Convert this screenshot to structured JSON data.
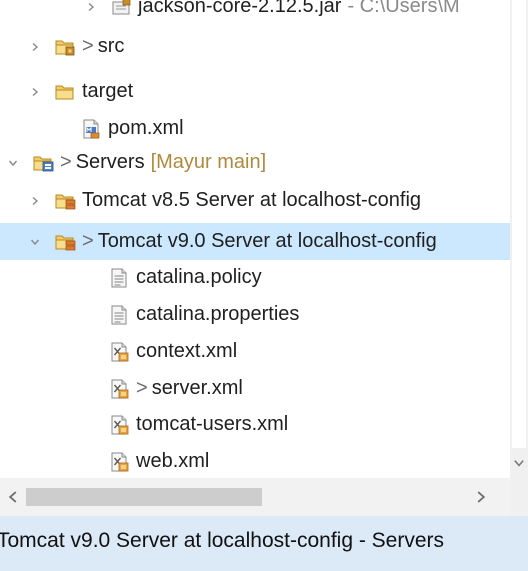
{
  "tree": {
    "items": [
      {
        "label": "jackson-core-2.12.5.jar",
        "location": "- C:\\Users\\M",
        "icon": "jar-icon",
        "state": "collapsed"
      },
      {
        "prefix": ">",
        "label": "src",
        "icon": "package-folder-icon",
        "state": "collapsed"
      },
      {
        "label": "target",
        "icon": "folder-icon",
        "state": "collapsed"
      },
      {
        "label": "pom.xml",
        "icon": "maven-file-icon"
      },
      {
        "prefix": ">",
        "label": "Servers",
        "decoration": "[Mayur main]",
        "icon": "project-folder-icon",
        "state": "expanded"
      },
      {
        "label": "Tomcat v8.5 Server at localhost-config",
        "icon": "server-folder-icon",
        "state": "collapsed"
      },
      {
        "prefix": ">",
        "label": "Tomcat v9.0 Server at localhost-config",
        "icon": "server-folder-icon",
        "state": "expanded",
        "selected": true
      },
      {
        "label": "catalina.policy",
        "icon": "text-file-icon"
      },
      {
        "label": "catalina.properties",
        "icon": "text-file-icon"
      },
      {
        "label": "context.xml",
        "icon": "xml-file-icon"
      },
      {
        "prefix": ">",
        "label": "server.xml",
        "icon": "xml-file-icon"
      },
      {
        "label": "tomcat-users.xml",
        "icon": "xml-file-icon"
      },
      {
        "label": "web.xml",
        "icon": "xml-file-icon"
      }
    ]
  },
  "status": {
    "text": "Tomcat v9.0 Server at localhost-config - Servers"
  },
  "colors": {
    "selection": "#cce8ff",
    "status_bar": "#dce9f7",
    "decoration": "#b08a3c",
    "folder": "#e8b84a"
  }
}
